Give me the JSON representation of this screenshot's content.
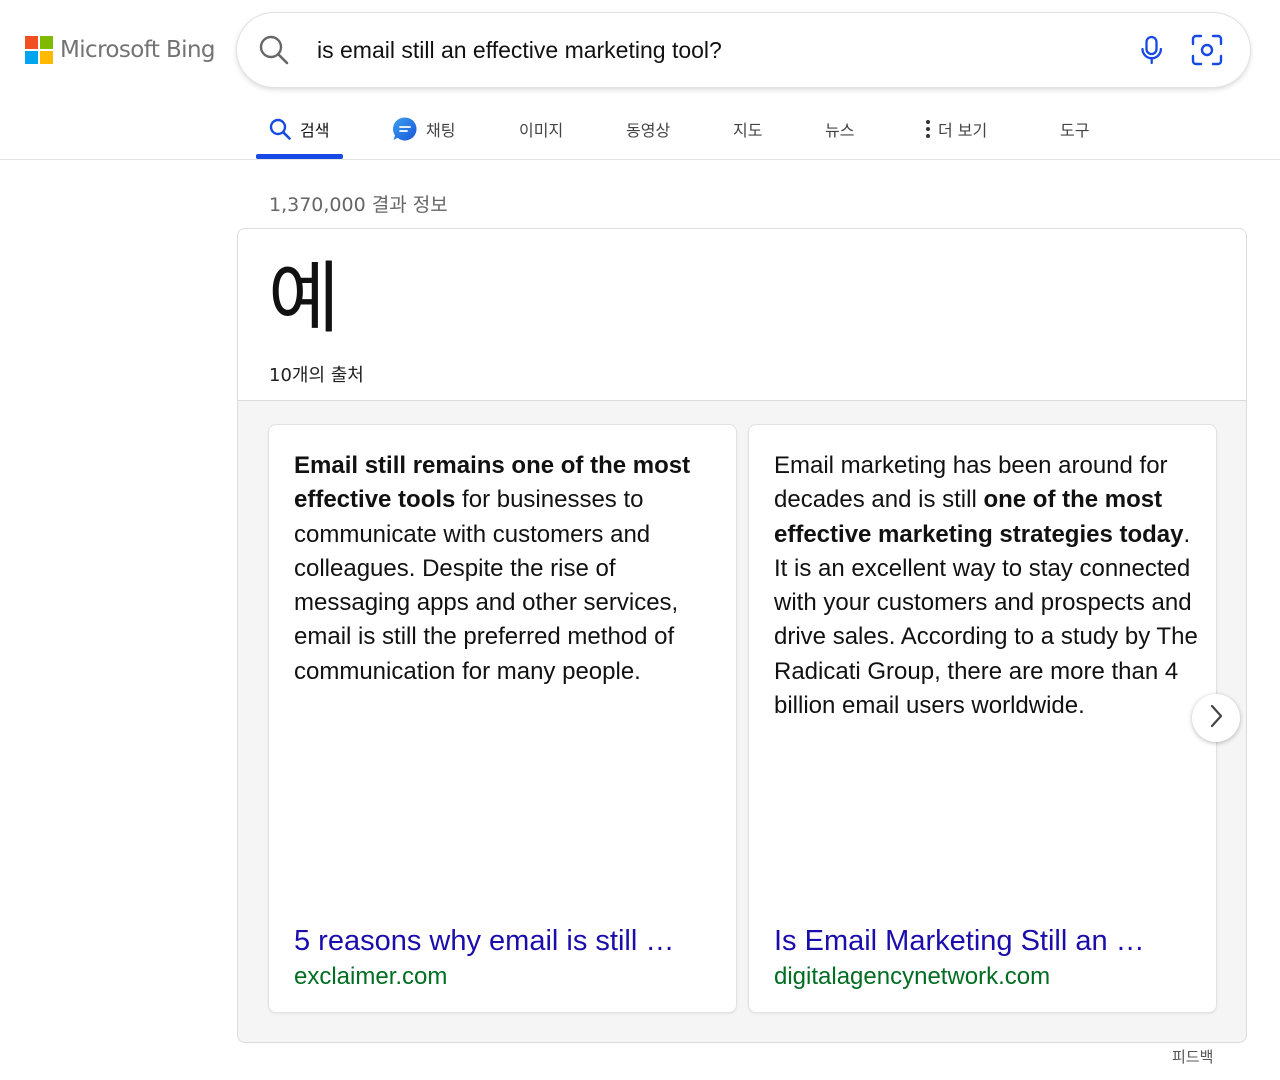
{
  "brand": {
    "logo_text": "Microsoft Bing",
    "logo_colors": [
      "#f25022",
      "#7fba00",
      "#00a4ef",
      "#ffb900"
    ]
  },
  "search": {
    "query": "is email still an effective marketing tool?",
    "search_icon": "search-icon",
    "mic_icon": "microphone-icon",
    "visual_icon": "visual-search-icon"
  },
  "nav": {
    "items": [
      {
        "label": "검색",
        "icon": "search-icon",
        "active": true
      },
      {
        "label": "채팅",
        "icon": "chat-bubble-icon"
      },
      {
        "label": "이미지"
      },
      {
        "label": "동영상"
      },
      {
        "label": "지도"
      },
      {
        "label": "뉴스"
      },
      {
        "label": "더 보기",
        "icon": "more-vertical-icon"
      },
      {
        "label": "도구"
      }
    ],
    "accent_color": "#174ae4"
  },
  "results": {
    "count_text": "1,370,000 결과 정보"
  },
  "answer": {
    "headline": "예",
    "sources_text": "10개의 출처",
    "cards": [
      {
        "text_bold": "Email still remains one of the most effective tools",
        "text_rest": " for businesses to communicate with customers and colleagues. Despite the rise of messaging apps and other services, email is still the preferred method of communication for many people.",
        "link_title": "5 reasons why email is still …",
        "domain": "exclaimer.com"
      },
      {
        "text_before": "Email marketing has been around for decades and is still ",
        "text_bold": "one of the most effective marketing strategies today",
        "text_after": ". It is an excellent way to stay connected with your customers and prospects and drive sales. According to a study by The Radicati Group, there are more than 4 billion email users worldwide.",
        "link_title": "Is Email Marketing Still an …",
        "domain": "digitalagencynetwork.com"
      }
    ],
    "next_icon": "chevron-right-icon",
    "link_color": "#1a0dab",
    "domain_color": "#006d21"
  },
  "feedback": {
    "label": "피드백"
  }
}
